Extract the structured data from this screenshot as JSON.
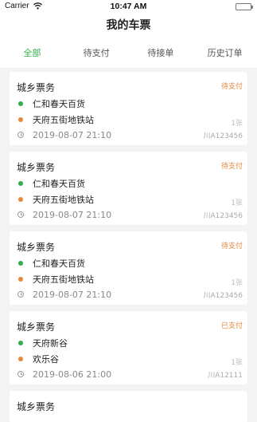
{
  "status_bar": {
    "carrier": "Carrier",
    "time": "10:47 AM"
  },
  "nav": {
    "title": "我的车票"
  },
  "tabs": [
    {
      "label": "全部",
      "active": true
    },
    {
      "label": "待支付",
      "active": false
    },
    {
      "label": "待接单",
      "active": false
    },
    {
      "label": "历史订单",
      "active": false
    }
  ],
  "colors": {
    "accent": "#2fb04a",
    "status": "#e28a3a"
  },
  "tickets": [
    {
      "type": "城乡票务",
      "status": "待支付",
      "from": "仁和春天百货",
      "to": "天府五街地铁站",
      "time": "2019-08-07 21:10",
      "count": "1张",
      "plate": "川A123456"
    },
    {
      "type": "城乡票务",
      "status": "待支付",
      "from": "仁和春天百货",
      "to": "天府五街地铁站",
      "time": "2019-08-07 21:10",
      "count": "1张",
      "plate": "川A123456"
    },
    {
      "type": "城乡票务",
      "status": "待支付",
      "from": "仁和春天百货",
      "to": "天府五街地铁站",
      "time": "2019-08-07 21:10",
      "count": "1张",
      "plate": "川A123456"
    },
    {
      "type": "城乡票务",
      "status": "已支付",
      "from": "天府新谷",
      "to": "欢乐谷",
      "time": "2019-08-06 21:00",
      "count": "1张",
      "plate": "川A12111"
    },
    {
      "type": "城乡票务"
    }
  ]
}
